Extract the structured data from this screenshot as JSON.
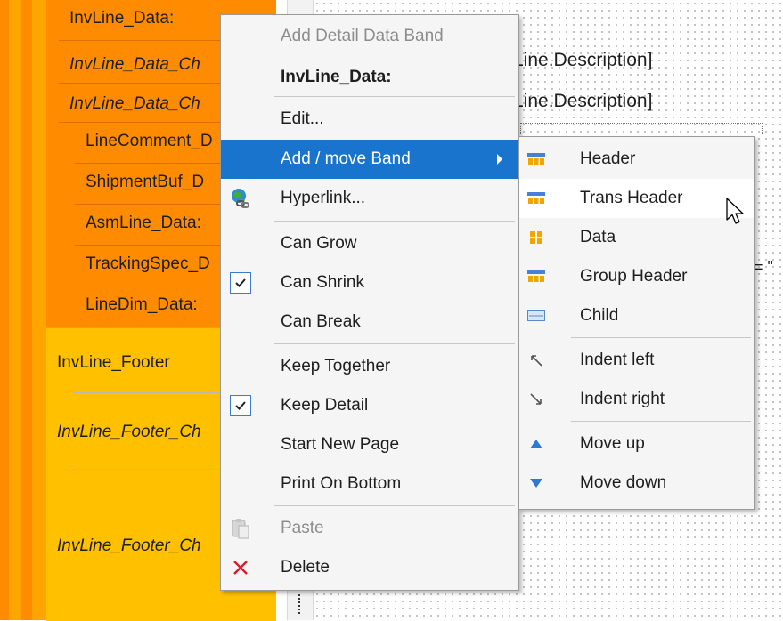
{
  "bands": {
    "data_items": [
      {
        "label": "InvLine_Data:",
        "italic": false
      },
      {
        "label": "InvLine_Data_Ch",
        "italic": true
      },
      {
        "label": "InvLine_Data_Ch",
        "italic": true
      },
      {
        "label": "LineComment_D",
        "italic": false
      },
      {
        "label": "ShipmentBuf_D",
        "italic": false
      },
      {
        "label": "AsmLine_Data:",
        "italic": false
      },
      {
        "label": "TrackingSpec_D",
        "italic": false
      },
      {
        "label": "LineDim_Data:",
        "italic": false
      }
    ],
    "footer_items": [
      {
        "label": "InvLine_Footer",
        "italic": false
      },
      {
        "label": "InvLine_Footer_Ch",
        "italic": true
      },
      {
        "label": "InvLine_Footer_Ch",
        "italic": true
      }
    ],
    "colors": {
      "orange": "#ff8c00",
      "yellow": "#ffc000",
      "highlight": "#1874cd"
    }
  },
  "canvas": {
    "field_1": "Line.Description]",
    "field_2": "Line.Description]",
    "quote_fragment": "= \""
  },
  "context_menu": {
    "items": [
      {
        "label": "Add Detail Data Band",
        "state": "disabled",
        "icon": null
      },
      {
        "label": "InvLine_Data:",
        "state": "bold",
        "icon": null
      },
      {
        "label": "Edit...",
        "state": "normal",
        "icon": null
      },
      {
        "label": "Add / move Band",
        "state": "highlighted",
        "icon": null,
        "has_submenu": true
      },
      {
        "label": "Hyperlink...",
        "state": "normal",
        "icon": "globe-link-icon"
      },
      {
        "label": "Can Grow",
        "state": "normal",
        "checked": false
      },
      {
        "label": "Can Shrink",
        "state": "normal",
        "checked": true
      },
      {
        "label": "Can Break",
        "state": "normal",
        "checked": false
      },
      {
        "label": "Keep Together",
        "state": "normal",
        "checked": false
      },
      {
        "label": "Keep Detail",
        "state": "normal",
        "checked": true
      },
      {
        "label": "Start New Page",
        "state": "normal",
        "checked": false
      },
      {
        "label": "Print On Bottom",
        "state": "normal",
        "checked": false
      },
      {
        "label": "Paste",
        "state": "disabled",
        "icon": "paste-icon"
      },
      {
        "label": "Delete",
        "state": "normal",
        "icon": "delete-x-icon"
      }
    ]
  },
  "submenu": {
    "items": [
      {
        "label": "Header",
        "icon": "band-header-icon"
      },
      {
        "label": "Trans Header",
        "icon": "band-header-icon",
        "state": "hover"
      },
      {
        "label": "Data",
        "icon": "band-data-icon"
      },
      {
        "label": "Group Header",
        "icon": "band-header-icon"
      },
      {
        "label": "Child",
        "icon": "band-child-icon"
      },
      {
        "label": "Indent left",
        "icon": "indent-left-arrow-icon"
      },
      {
        "label": "Indent right",
        "icon": "indent-right-arrow-icon"
      },
      {
        "label": "Move up",
        "icon": "move-up-icon"
      },
      {
        "label": "Move down",
        "icon": "move-down-icon"
      }
    ]
  }
}
